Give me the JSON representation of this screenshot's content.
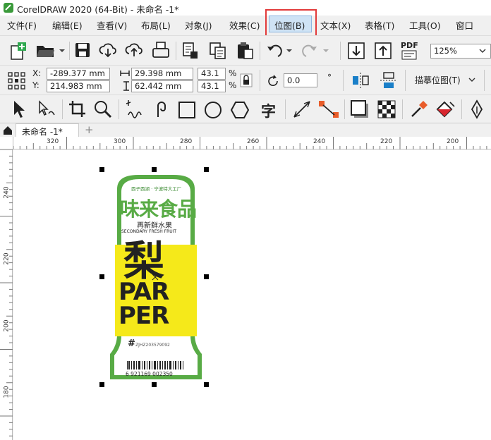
{
  "window": {
    "title": "CorelDRAW 2020 (64-Bit) - 未命名 -1*"
  },
  "menu": [
    {
      "label": "文件(F)"
    },
    {
      "label": "编辑(E)"
    },
    {
      "label": "查看(V)"
    },
    {
      "label": "布局(L)"
    },
    {
      "label": "对象(J)"
    },
    {
      "label": "效果(C)"
    },
    {
      "label": "位图(B)"
    },
    {
      "label": "文本(X)"
    },
    {
      "label": "表格(T)"
    },
    {
      "label": "工具(O)"
    },
    {
      "label": "窗口"
    }
  ],
  "toolbar": {
    "zoom": "125%",
    "pdf_label": "PDF"
  },
  "properties": {
    "x_label": "X:",
    "x": "-289.377 mm",
    "y_label": "Y:",
    "y": "214.983 mm",
    "width": "29.398 mm",
    "height": "62.442 mm",
    "scale_w": "43.1",
    "scale_h": "43.1",
    "pct": "%",
    "rotation": "0.0",
    "deg": "°",
    "trace_label": "描摹位图(T)"
  },
  "doc_tab": {
    "label": "未命名 -1*",
    "add": "+"
  },
  "ruler": {
    "h_ticks": [
      "320",
      "300",
      "280",
      "260",
      "240",
      "220",
      "200"
    ],
    "v_ticks": [
      "240",
      "220",
      "200",
      "180"
    ]
  },
  "label_art": {
    "top_small": "西子西湖 · 宁波特大工厂",
    "brand": "味来食品",
    "sub_cn": "再新鲜水果",
    "sub_en": "SECONDARY FRESH FRUIT",
    "big1": "梨",
    "big2": "PAR",
    "big3": "PER",
    "code": "ZJHZ203579092",
    "hash": "#",
    "barcode_num": "6 921169 002350"
  },
  "colors": {
    "accent_red": "#e23a3a",
    "label_green": "#58ab45",
    "label_yellow": "#f5e91a",
    "highlight": "#cfe3f5"
  }
}
